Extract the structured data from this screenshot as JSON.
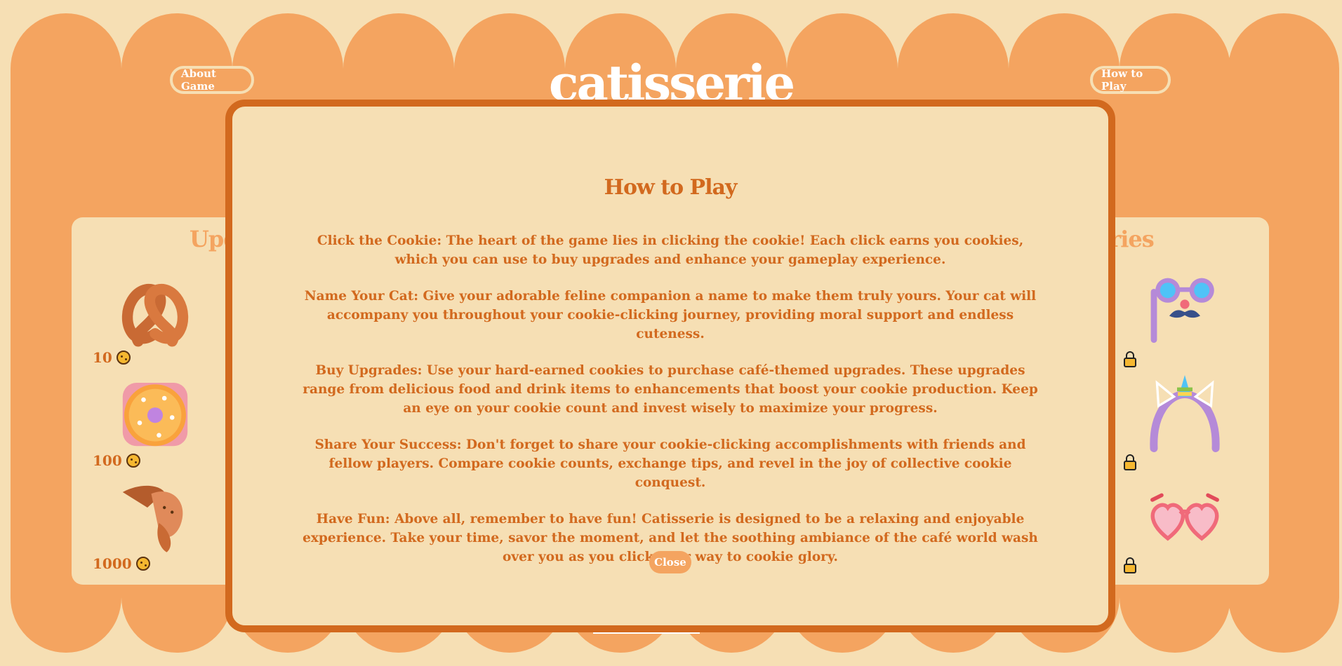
{
  "header": {
    "title": "catisserie",
    "about_label": "About Game",
    "how_label": "How to Play"
  },
  "upgrades_panel": {
    "title": "Upg",
    "items": [
      {
        "icon": "pretzel-icon",
        "price": "10"
      },
      {
        "icon": "donut-icon",
        "price": "100"
      },
      {
        "icon": "croissant-icon",
        "price": "1000"
      }
    ]
  },
  "accessories_panel": {
    "title": "ories",
    "items": [
      {
        "icon": "glasses-mustache-icon",
        "locked": true
      },
      {
        "icon": "unicorn-headband-icon",
        "locked": true
      },
      {
        "icon": "heart-glasses-icon",
        "locked": true
      }
    ]
  },
  "modal": {
    "title": "How to Play",
    "paragraphs": [
      "Click the Cookie: The heart of the game lies in clicking the cookie! Each click earns you cookies, which you can use to buy upgrades and enhance your gameplay experience.",
      "Name Your Cat: Give your adorable feline companion a name to make them truly yours. Your cat will accompany you throughout your cookie-clicking journey, providing moral support and endless cuteness.",
      "Buy Upgrades: Use your hard-earned cookies to purchase café-themed upgrades. These upgrades range from delicious food and drink items to enhancements that boost your cookie production. Keep an eye on your cookie count and invest wisely to maximize your progress.",
      "Share Your Success: Don't forget to share your cookie-clicking accomplishments with friends and fellow players. Compare cookie counts, exchange tips, and revel in the joy of collective cookie conquest.",
      "Have Fun: Above all, remember to have fun! Catisserie is designed to be a relaxing and enjoyable experience. Take your time, savor the moment, and let the soothing ambiance of the café world wash over you as you click your way to cookie glory."
    ],
    "close_label": "Close"
  },
  "colors": {
    "background": "#f6dfb4",
    "scallop": "#f4a460",
    "accent": "#d2691e"
  }
}
